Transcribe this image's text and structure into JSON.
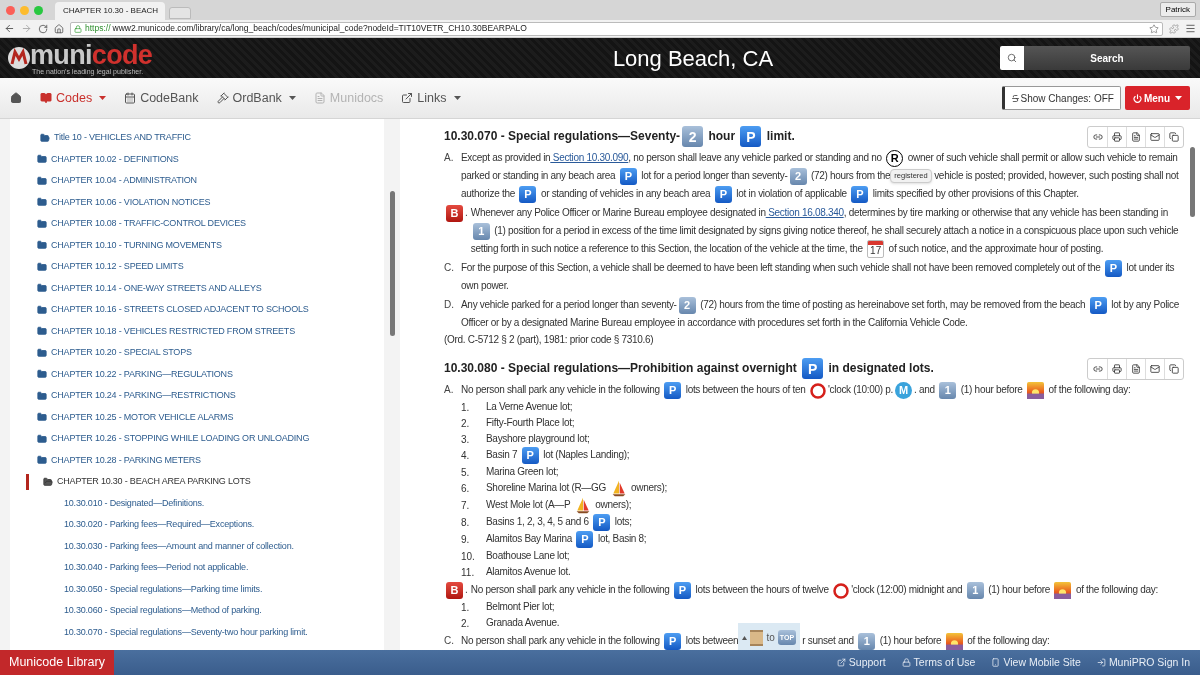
{
  "browser": {
    "tab_title": "CHAPTER 10.30 - BEACH",
    "user": "Patrick",
    "url_scheme": "https://",
    "url_rest": "www2.municode.com/library/ca/long_beach/codes/municipal_code?nodeId=TIT10VETR_CH10.30BEARPALO"
  },
  "header": {
    "logo_a": "muni",
    "logo_b": "code",
    "tagline": "The nation's leading legal publisher.",
    "city": "Long Beach, CA",
    "search_button": "Search"
  },
  "nav": {
    "items": [
      {
        "kind": "home",
        "caret": false,
        "selected": false,
        "disabled": false
      },
      {
        "kind": "book",
        "label": "Codes",
        "caret": true,
        "selected": true,
        "disabled": false
      },
      {
        "kind": "calendar",
        "label": "CodeBank",
        "caret": false,
        "selected": false,
        "disabled": false
      },
      {
        "kind": "gavel",
        "label": "OrdBank",
        "caret": true,
        "selected": false,
        "disabled": false
      },
      {
        "kind": "file",
        "label": "Munidocs",
        "caret": false,
        "selected": false,
        "disabled": true
      },
      {
        "kind": "external",
        "label": "Links",
        "caret": true,
        "selected": false,
        "disabled": false
      }
    ],
    "show_changes": "Show Changes: OFF",
    "menu": "Menu"
  },
  "sidebar": {
    "items": [
      {
        "label": "Title 10 - VEHICLES AND TRAFFIC",
        "expanded": true,
        "children": [
          {
            "label": "CHAPTER 10.02 - DEFINITIONS",
            "expanded": false,
            "selected": false
          },
          {
            "label": "CHAPTER 10.04 - ADMINISTRATION",
            "expanded": false,
            "selected": false
          },
          {
            "label": "CHAPTER 10.06 - VIOLATION NOTICES",
            "expanded": false,
            "selected": false
          },
          {
            "label": "CHAPTER 10.08 - TRAFFIC-CONTROL DEVICES",
            "expanded": false,
            "selected": false
          },
          {
            "label": "CHAPTER 10.10 - TURNING MOVEMENTS",
            "expanded": false,
            "selected": false
          },
          {
            "label": "CHAPTER 10.12 - SPEED LIMITS",
            "expanded": false,
            "selected": false
          },
          {
            "label": "CHAPTER 10.14 - ONE-WAY STREETS AND ALLEYS",
            "expanded": false,
            "selected": false
          },
          {
            "label": "CHAPTER 10.16 - STREETS CLOSED ADJACENT TO SCHOOLS",
            "expanded": false,
            "selected": false
          },
          {
            "label": "CHAPTER 10.18 - VEHICLES RESTRICTED FROM STREETS",
            "expanded": false,
            "selected": false
          },
          {
            "label": "CHAPTER 10.20 - SPECIAL STOPS",
            "expanded": false,
            "selected": false
          },
          {
            "label": "CHAPTER 10.22 - PARKING—REGULATIONS",
            "expanded": false,
            "selected": false
          },
          {
            "label": "CHAPTER 10.24 - PARKING—RESTRICTIONS",
            "expanded": false,
            "selected": false
          },
          {
            "label": "CHAPTER 10.25 - MOTOR VEHICLE ALARMS",
            "expanded": false,
            "selected": false
          },
          {
            "label": "CHAPTER 10.26 - STOPPING WHILE LOADING OR UNLOADING",
            "expanded": false,
            "selected": false
          },
          {
            "label": "CHAPTER 10.28 - PARKING METERS",
            "expanded": false,
            "selected": false
          },
          {
            "label": "CHAPTER 10.30 - BEACH AREA PARKING LOTS",
            "expanded": true,
            "selected": true,
            "children": [
              {
                "label": "10.30.010 - Designated—Definitions."
              },
              {
                "label": "10.30.020 - Parking fees—Required—Exceptions."
              },
              {
                "label": "10.30.030 - Parking fees—Amount and manner of collection."
              },
              {
                "label": "10.30.040 - Parking fees—Period not applicable."
              },
              {
                "label": "10.30.050 - Special regulations—Parking time limits."
              },
              {
                "label": "10.30.060 - Special regulations—Method of parking."
              },
              {
                "label": "10.30.070 - Special regulations—Seventy-two hour parking limit."
              }
            ]
          }
        ]
      }
    ]
  },
  "sections": [
    {
      "title": [
        {
          "kind": "text",
          "text": "10.30.070 - Special regulations—Seventy-"
        },
        {
          "kind": "number",
          "text": "2"
        },
        {
          "kind": "text",
          "text": " hour "
        },
        {
          "kind": "parking",
          "text": "P"
        },
        {
          "kind": "text",
          "text": " limit."
        }
      ],
      "paragraphs": [
        {
          "marker": [
            {
              "kind": "text",
              "text": "A."
            }
          ],
          "segments": [
            {
              "kind": "text",
              "text": "Except as provided in"
            },
            {
              "kind": "link",
              "text": " Section 10.30.090"
            },
            {
              "kind": "text",
              "text": ", no person shall leave any vehicle parked or standing and no "
            },
            {
              "kind": "registered",
              "text": "R"
            },
            {
              "kind": "text",
              "text": " owner of such vehicle shall permit or allow such vehicle to remain parked or standing in any beach area "
            },
            {
              "kind": "parking",
              "text": "P"
            },
            {
              "kind": "text",
              "text": " lot for a period longer than seventy-"
            },
            {
              "kind": "number",
              "text": "2"
            },
            {
              "kind": "text",
              "text": " (72) hours from the"
            },
            {
              "kind": "tooltip",
              "text": "registered"
            },
            {
              "kind": "text",
              "text": " vehicle is posted; provided, however, such posting shall not authorize the "
            },
            {
              "kind": "parking",
              "text": "P"
            },
            {
              "kind": "text",
              "text": " or standing of vehicles in any beach area "
            },
            {
              "kind": "parking",
              "text": "P"
            },
            {
              "kind": "text",
              "text": " lot in violation of applicable "
            },
            {
              "kind": "parking",
              "text": "P"
            },
            {
              "kind": "text",
              "text": " limits specified by other provisions of this Chapter."
            }
          ]
        },
        {
          "marker": [
            {
              "kind": "letter",
              "text": "B"
            },
            {
              "kind": "text",
              "text": "."
            }
          ],
          "segments": [
            {
              "kind": "text",
              "text": "Whenever any Police Officer or Marine Bureau employee designated in"
            },
            {
              "kind": "link",
              "text": " Section 16.08.340"
            },
            {
              "kind": "text",
              "text": ", determines by tire marking or otherwise that any vehicle has been standing in "
            },
            {
              "kind": "number",
              "text": "1"
            },
            {
              "kind": "text",
              "text": " (1) position for a period in excess of the time limit designated by signs giving notice thereof, he shall securely attach a notice in a conspicuous place upon such vehicle setting forth in such notice a reference to this Section, the location of the vehicle at the time, the "
            },
            {
              "kind": "calendar",
              "text": "17"
            },
            {
              "kind": "text",
              "text": " of such notice, and the approximate hour of posting."
            }
          ]
        },
        {
          "marker": [
            {
              "kind": "text",
              "text": "C."
            }
          ],
          "segments": [
            {
              "kind": "text",
              "text": "For the purpose of this Section, a vehicle shall be deemed to have been left standing when such vehicle shall not have been removed completely out of the "
            },
            {
              "kind": "parking",
              "text": "P"
            },
            {
              "kind": "text",
              "text": " lot under its own power."
            }
          ]
        },
        {
          "marker": [
            {
              "kind": "text",
              "text": "D."
            }
          ],
          "segments": [
            {
              "kind": "text",
              "text": "Any vehicle parked for a period longer than seventy-"
            },
            {
              "kind": "number",
              "text": "2"
            },
            {
              "kind": "text",
              "text": " (72) hours from the time of posting as hereinabove set forth, may be removed from the beach "
            },
            {
              "kind": "parking",
              "text": "P"
            },
            {
              "kind": "text",
              "text": " lot by any Police Officer or by a designated Marine Bureau employee in accordance with procedures set forth in the California Vehicle Code."
            }
          ]
        }
      ],
      "note": "(Ord. C-5712 § 2 (part), 1981: prior code § 7310.6)"
    },
    {
      "title": [
        {
          "kind": "text",
          "text": "10.30.080 - Special regulations—Prohibition against overnight "
        },
        {
          "kind": "parking",
          "text": "P"
        },
        {
          "kind": "text",
          "text": " in designated lots."
        }
      ],
      "paragraphs": [
        {
          "marker": [
            {
              "kind": "text",
              "text": "A."
            }
          ],
          "segments": [
            {
              "kind": "text",
              "text": "No person shall park any vehicle in the following "
            },
            {
              "kind": "parking",
              "text": "P"
            },
            {
              "kind": "text",
              "text": " lots between the hours of ten "
            },
            {
              "kind": "ring"
            },
            {
              "kind": "text",
              "text": "'clock (10:00) p."
            },
            {
              "kind": "metro",
              "text": "M"
            },
            {
              "kind": "text",
              "text": ". and "
            },
            {
              "kind": "number",
              "text": "1"
            },
            {
              "kind": "text",
              "text": " (1) hour before "
            },
            {
              "kind": "sunset"
            },
            {
              "kind": "text",
              "text": " of the following day:"
            }
          ],
          "list": [
            {
              "number": "1.",
              "segments": [
                {
                  "kind": "text",
                  "text": "La Verne Avenue lot;"
                }
              ]
            },
            {
              "number": "2.",
              "segments": [
                {
                  "kind": "text",
                  "text": "Fifty-Fourth Place lot;"
                }
              ]
            },
            {
              "number": "3.",
              "segments": [
                {
                  "kind": "text",
                  "text": "Bayshore playground lot;"
                }
              ]
            },
            {
              "number": "4.",
              "segments": [
                {
                  "kind": "text",
                  "text": "Basin 7 "
                },
                {
                  "kind": "parking",
                  "text": "P"
                },
                {
                  "kind": "text",
                  "text": " lot (Naples Landing);"
                }
              ]
            },
            {
              "number": "5.",
              "segments": [
                {
                  "kind": "text",
                  "text": "Marina Green lot;"
                }
              ]
            },
            {
              "number": "6.",
              "segments": [
                {
                  "kind": "text",
                  "text": "Shoreline Marina lot (R—GG "
                },
                {
                  "kind": "sailboat"
                },
                {
                  "kind": "text",
                  "text": " owners);"
                }
              ]
            },
            {
              "number": "7.",
              "segments": [
                {
                  "kind": "text",
                  "text": "West Mole lot (A—P "
                },
                {
                  "kind": "sailboat"
                },
                {
                  "kind": "text",
                  "text": " owners);"
                }
              ]
            },
            {
              "number": "8.",
              "segments": [
                {
                  "kind": "text",
                  "text": "Basins 1, 2, 3, 4, 5 and 6 "
                },
                {
                  "kind": "parking",
                  "text": "P"
                },
                {
                  "kind": "text",
                  "text": " lots;"
                }
              ]
            },
            {
              "number": "9.",
              "segments": [
                {
                  "kind": "text",
                  "text": "Alamitos Bay Marina "
                },
                {
                  "kind": "parking",
                  "text": "P"
                },
                {
                  "kind": "text",
                  "text": " lot, Basin 8;"
                }
              ]
            },
            {
              "number": "10.",
              "segments": [
                {
                  "kind": "text",
                  "text": "Boathouse Lane lot;"
                }
              ]
            },
            {
              "number": "11.",
              "segments": [
                {
                  "kind": "text",
                  "text": "Alamitos Avenue lot."
                }
              ]
            }
          ]
        },
        {
          "marker": [
            {
              "kind": "letter",
              "text": "B"
            },
            {
              "kind": "text",
              "text": "."
            }
          ],
          "segments": [
            {
              "kind": "text",
              "text": "No person shall park any vehicle in the following "
            },
            {
              "kind": "parking",
              "text": "P"
            },
            {
              "kind": "text",
              "text": " lots between the hours of twelve "
            },
            {
              "kind": "ring"
            },
            {
              "kind": "text",
              "text": "'clock (12:00) midnight and "
            },
            {
              "kind": "number",
              "text": "1"
            },
            {
              "kind": "text",
              "text": " (1) hour before "
            },
            {
              "kind": "sunset"
            },
            {
              "kind": "text",
              "text": " of the following day:"
            }
          ],
          "list": [
            {
              "number": "1.",
              "segments": [
                {
                  "kind": "text",
                  "text": "Belmont Pier lot;"
                }
              ]
            },
            {
              "number": "2.",
              "segments": [
                {
                  "kind": "text",
                  "text": "Granada Avenue."
                }
              ]
            }
          ]
        },
        {
          "marker": [
            {
              "kind": "text",
              "text": "C."
            }
          ],
          "segments": [
            {
              "kind": "text",
              "text": "No person shall park any vehicle in the following "
            },
            {
              "kind": "parking",
              "text": "P"
            },
            {
              "kind": "text",
              "text": " lots between"
            },
            {
              "kind": "gap"
            },
            {
              "kind": "text",
              "text": "r sunset and "
            },
            {
              "kind": "number",
              "text": "1"
            },
            {
              "kind": "text",
              "text": " (1) hour before "
            },
            {
              "kind": "sunset"
            },
            {
              "kind": "text",
              "text": " of the following day:"
            }
          ]
        }
      ]
    }
  ],
  "to_top": {
    "text": "to",
    "key": "TOP"
  },
  "footer": {
    "library": "Municode Library",
    "links": [
      {
        "kind": "external",
        "label": "Support"
      },
      {
        "kind": "lock",
        "label": "Terms of Use"
      },
      {
        "kind": "mobile",
        "label": "View Mobile Site"
      },
      {
        "kind": "signin",
        "label": "MuniPRO Sign In"
      }
    ]
  }
}
